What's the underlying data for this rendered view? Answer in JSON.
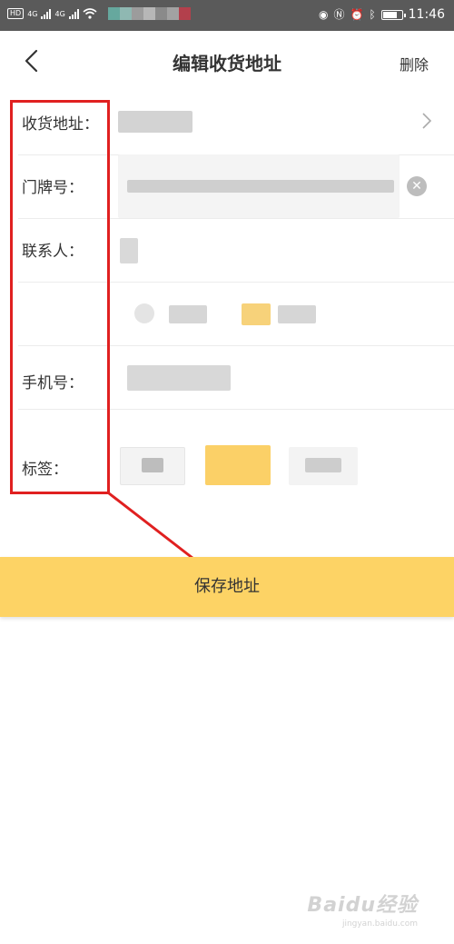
{
  "status_bar": {
    "hd_badge": "HD",
    "signal_1": "4G",
    "signal_2": "4G",
    "time": "11:46",
    "battery_level": 0.7
  },
  "header": {
    "title": "编辑收货地址",
    "delete_label": "删除"
  },
  "form": {
    "address_label": "收货地址：",
    "door_label": "门牌号：",
    "contact_label": "联系人：",
    "phone_label": "手机号：",
    "tag_label": "标签："
  },
  "save_label": "保存地址",
  "watermark": {
    "main": "Baidu经验",
    "sub": "jingyan.baidu.com"
  },
  "colors": {
    "accent": "#fdd365",
    "annotation": "#e02020",
    "status_bar": "#5a5a5a"
  },
  "icons": {
    "back": "chevron-left-icon",
    "next": "chevron-right-icon",
    "clear": "clear-icon",
    "gender": "radio-icon"
  }
}
